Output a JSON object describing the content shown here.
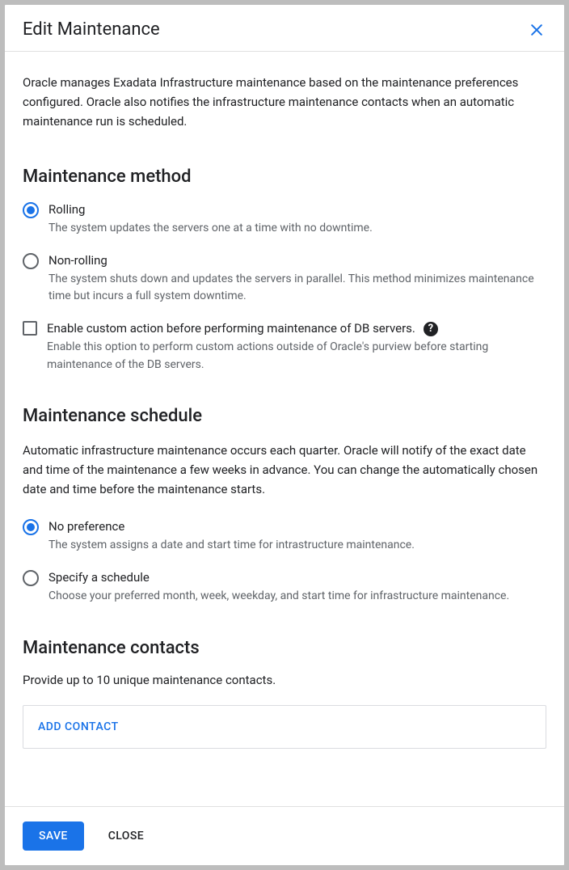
{
  "dialog": {
    "title": "Edit Maintenance",
    "intro": "Oracle manages Exadata Infrastructure maintenance based on the maintenance preferences configured. Oracle also notifies the infrastructure maintenance contacts when an automatic maintenance run is scheduled."
  },
  "method": {
    "heading": "Maintenance method",
    "rolling": {
      "label": "Rolling",
      "desc": "The system updates the servers one at a time with no downtime."
    },
    "nonrolling": {
      "label": "Non-rolling",
      "desc": "The system shuts down and updates the servers in parallel. This method minimizes maintenance time but incurs a full system downtime."
    },
    "custom": {
      "label": "Enable custom action before performing maintenance of DB servers.",
      "desc": "Enable this option to perform custom actions outside of Oracle's purview before starting maintenance of the DB servers."
    }
  },
  "schedule": {
    "heading": "Maintenance schedule",
    "desc": "Automatic infrastructure maintenance occurs each quarter. Oracle will notify of the exact date and time of the maintenance a few weeks in advance. You can change the automatically chosen date and time before the maintenance starts.",
    "nopref": {
      "label": "No preference",
      "desc": "The system assigns a date and start time for intrastructure maintenance."
    },
    "specify": {
      "label": "Specify a schedule",
      "desc": "Choose your preferred month, week, weekday, and start time for infrastructure maintenance."
    }
  },
  "contacts": {
    "heading": "Maintenance contacts",
    "desc": "Provide up to 10 unique maintenance contacts.",
    "add_label": "ADD CONTACT"
  },
  "footer": {
    "save": "SAVE",
    "close": "CLOSE"
  }
}
